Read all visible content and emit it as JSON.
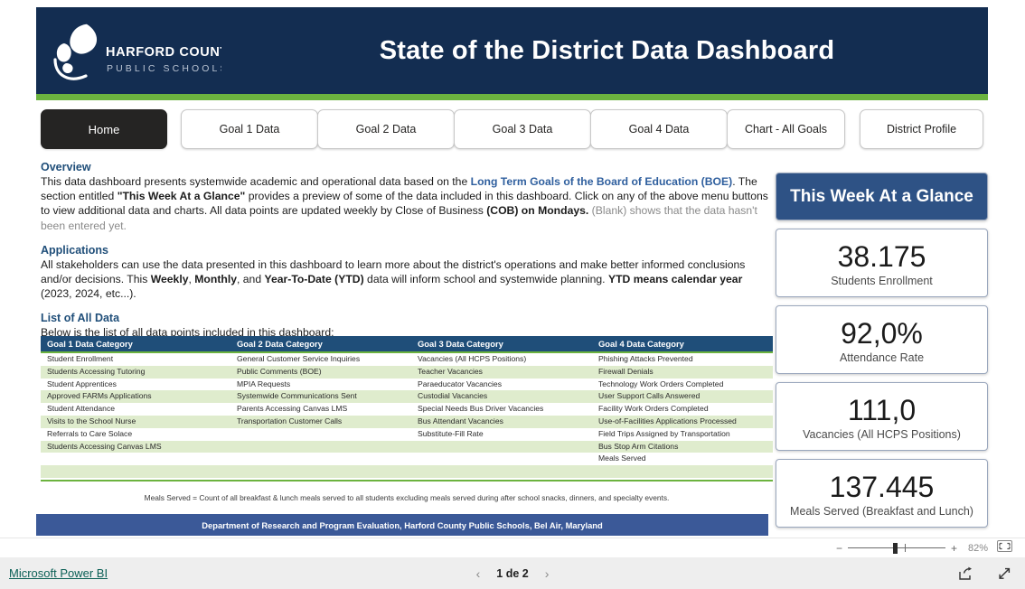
{
  "header": {
    "title": "State of the District Data Dashboard",
    "logo_line1": "HARFORD COUNTY",
    "logo_line2": "PUBLIC SCHOOLS",
    "banner_color": "#132d51",
    "accent_color": "#6cb33f"
  },
  "nav": {
    "items": [
      {
        "label": "Home",
        "active": true
      },
      {
        "label": "Goal 1 Data",
        "active": false
      },
      {
        "label": "Goal 2 Data",
        "active": false
      },
      {
        "label": "Goal 3 Data",
        "active": false
      },
      {
        "label": "Goal 4 Data",
        "active": false
      },
      {
        "label": "Chart - All Goals",
        "active": false
      },
      {
        "label": "District Profile",
        "active": false
      }
    ]
  },
  "overview": {
    "heading": "Overview",
    "p1_a": "This data dashboard presents systemwide academic and operational data based on the ",
    "p1_link": "Long Term Goals of the Board of Education (BOE)",
    "p1_b": ". The section entitled ",
    "p1_bold1": "\"This Week At a Glance\"",
    "p1_c": " provides a preview of some of the data included in this dashboard. Click on any of the above menu buttons to view additional data and charts. All data points are updated weekly by Close of Business ",
    "p1_bold2": "(COB) on Mondays.",
    "p1_muted": " (Blank) shows that the data hasn't been entered yet."
  },
  "applications": {
    "heading": "Applications",
    "p_a": "All stakeholders can use the data presented in this dashboard to learn more about the district's operations and make better informed conclusions and/or decisions. This ",
    "b1": "Weekly",
    "p_b": ", ",
    "b2": "Monthly",
    "p_c": ", and ",
    "b3": "Year-To-Date (YTD)",
    "p_d": " data will inform school and systemwide planning. ",
    "b4": "YTD means calendar year",
    "p_e": " (2023, 2024,  etc...)."
  },
  "list_section": {
    "heading": "List of All Data",
    "subheading": "Below is the list of all data points included in this dashboard:"
  },
  "table": {
    "headers": [
      "Goal 1 Data Category",
      "Goal 2 Data Category",
      "Goal 3 Data Category",
      "Goal 4 Data Category"
    ],
    "columns": [
      [
        "Student Enrollment",
        "Students Accessing Tutoring",
        "Student Apprentices",
        "Approved FARMs Applications",
        "Student Attendance",
        "Visits to the School Nurse",
        "Referrals to Care Solace",
        "Students Accessing Canvas LMS",
        "",
        ""
      ],
      [
        "General Customer Service Inquiries",
        "Public Comments (BOE)",
        "MPIA Requests",
        "Systemwide Communications Sent",
        "Parents Accessing Canvas LMS",
        "Transportation Customer Calls",
        "",
        "",
        "",
        ""
      ],
      [
        "Vacancies (All HCPS Positions)",
        "Teacher Vacancies",
        "Paraeducator Vacancies",
        "Custodial Vacancies",
        "Special Needs Bus Driver Vacancies",
        "Bus Attendant Vacancies",
        "Substitute-Fill Rate",
        "",
        "",
        ""
      ],
      [
        "Phishing Attacks Prevented",
        "Firewall Denials",
        "Technology Work Orders Completed",
        "User Support Calls Answered",
        "Facility Work Orders Completed",
        "Use-of-Facilities Applications Processed",
        "Field Trips Assigned by Transportation",
        "Bus Stop Arm Citations",
        "Meals Served",
        ""
      ]
    ]
  },
  "note": "Meals Served = Count of all breakfast & lunch meals served to all students excluding meals served during after school snacks, dinners, and specialty events.",
  "report_footer": "Department of Research and Program Evaluation, Harford County Public Schools, Bel Air, Maryland",
  "glance": {
    "title": "This Week At a Glance",
    "cards": [
      {
        "value": "38.175",
        "label": "Students Enrollment"
      },
      {
        "value": "92,0%",
        "label": "Attendance Rate"
      },
      {
        "value": "111,0",
        "label": "Vacancies (All HCPS Positions)"
      },
      {
        "value": "137.445",
        "label": "Meals Served (Breakfast and Lunch)"
      }
    ]
  },
  "zoombar": {
    "minus": "−",
    "plus": "+",
    "percent": "82%",
    "fit_icon": "fit-to-page-icon"
  },
  "statusbar": {
    "brand": "Microsoft Power BI",
    "prev_icon": "chevron-left-icon",
    "page_label": "1 de 2",
    "next_icon": "chevron-right-icon",
    "share_icon": "share-icon",
    "fullscreen_icon": "fullscreen-icon"
  }
}
